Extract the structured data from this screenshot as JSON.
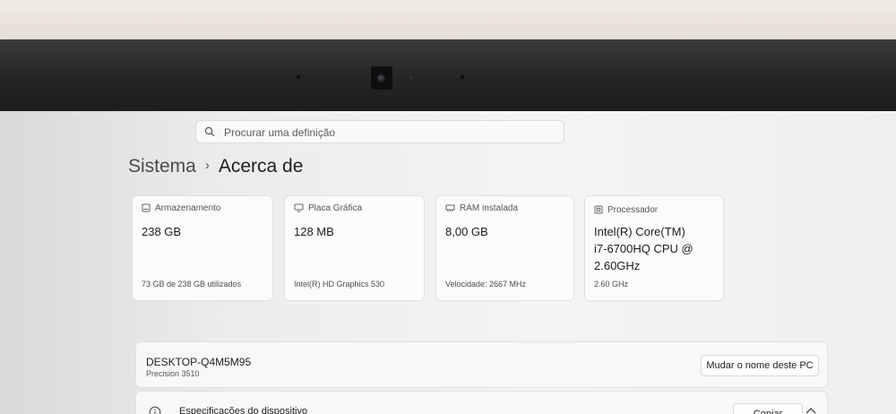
{
  "search": {
    "placeholder": "Procurar uma definição"
  },
  "breadcrumb": {
    "parent": "Sistema",
    "separator": "›",
    "current": "Acerca de"
  },
  "cards": [
    {
      "label": "Armazenamento",
      "value": "238 GB",
      "sub": "73 GB de 238 GB utilizados",
      "icon": "storage-icon"
    },
    {
      "label": "Placa Gráfica",
      "value": "128 MB",
      "sub": "Intel(R) HD Graphics 530",
      "icon": "display-icon"
    },
    {
      "label": "RAM instalada",
      "value": "8,00 GB",
      "sub": "Velocidade: 2667 MHz",
      "icon": "memory-icon"
    },
    {
      "label": "Processador",
      "value_lines": [
        "Intel(R) Core(TM)",
        "i7-6700HQ CPU @",
        "2.60GHz"
      ],
      "sub": "2.60 GHz",
      "icon": "cpu-icon"
    }
  ],
  "device": {
    "name": "DESKTOP-Q4M5M95",
    "model": "Precision 3510",
    "rename_label": "Mudar o nome deste PC"
  },
  "specs": {
    "title": "Especificações do dispositivo",
    "copy_label": "Copiar"
  }
}
